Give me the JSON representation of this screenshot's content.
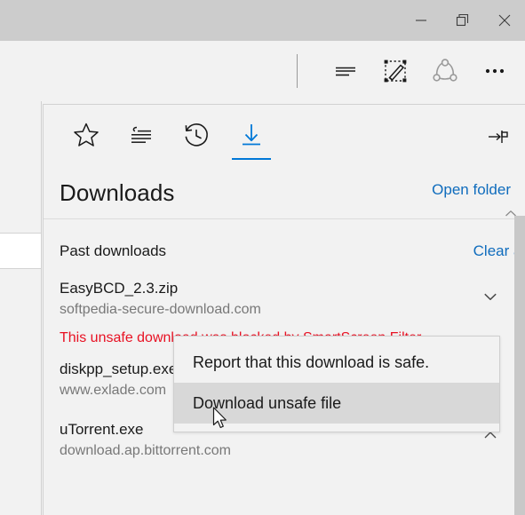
{
  "window": {
    "titlebar_color": "#cccccc",
    "buttons": [
      {
        "name": "minimize",
        "label": "Minimize"
      },
      {
        "name": "restore",
        "label": "Restore Down"
      },
      {
        "name": "close",
        "label": "Close"
      }
    ]
  },
  "toolbar": {
    "items": [
      {
        "name": "reading-view-icon",
        "label": "Reading view"
      },
      {
        "name": "web-note-icon",
        "label": "Make a Web Note"
      },
      {
        "name": "share-icon",
        "label": "Share"
      },
      {
        "name": "more-icon",
        "label": "More"
      }
    ]
  },
  "hub": {
    "tabs": [
      {
        "name": "favorites",
        "label": "Favorites",
        "selected": false
      },
      {
        "name": "reading-list",
        "label": "Reading list",
        "selected": false
      },
      {
        "name": "history",
        "label": "History",
        "selected": false
      },
      {
        "name": "downloads",
        "label": "Downloads",
        "selected": true
      }
    ],
    "pin_label": "Pin this pane",
    "title": "Downloads",
    "open_folder_label": "Open folder",
    "accent_color": "#0078d7",
    "link_color": "#0f6cbd",
    "warning_color": "#e81123"
  },
  "downloads": {
    "section_label": "Past downloads",
    "clear_all_label": "Clear all",
    "items": [
      {
        "name": "EasyBCD_2.3.zip",
        "url": "softpedia-secure-download.com",
        "warning": "This unsafe download was blocked by SmartScreen Filter.",
        "warning_visible_text": "This unsafe dow",
        "warning_visible_text_line2": "Filter.",
        "action_icon": "chevron-down-icon"
      },
      {
        "name": "diskpp_setup.exe",
        "name_visible_text": "diskpp_setup.e",
        "url": "www.exlade.com",
        "url_visible_text": "www.exlade.co",
        "action_icon": "close-icon"
      },
      {
        "name": "uTorrent.exe",
        "url": "download.ap.bittorrent.com",
        "action_icon": "close-icon"
      }
    ]
  },
  "context_menu": {
    "items": [
      {
        "label": "Report that this download is safe.",
        "hovered": false
      },
      {
        "label": "Download unsafe file",
        "hovered": true
      }
    ]
  }
}
